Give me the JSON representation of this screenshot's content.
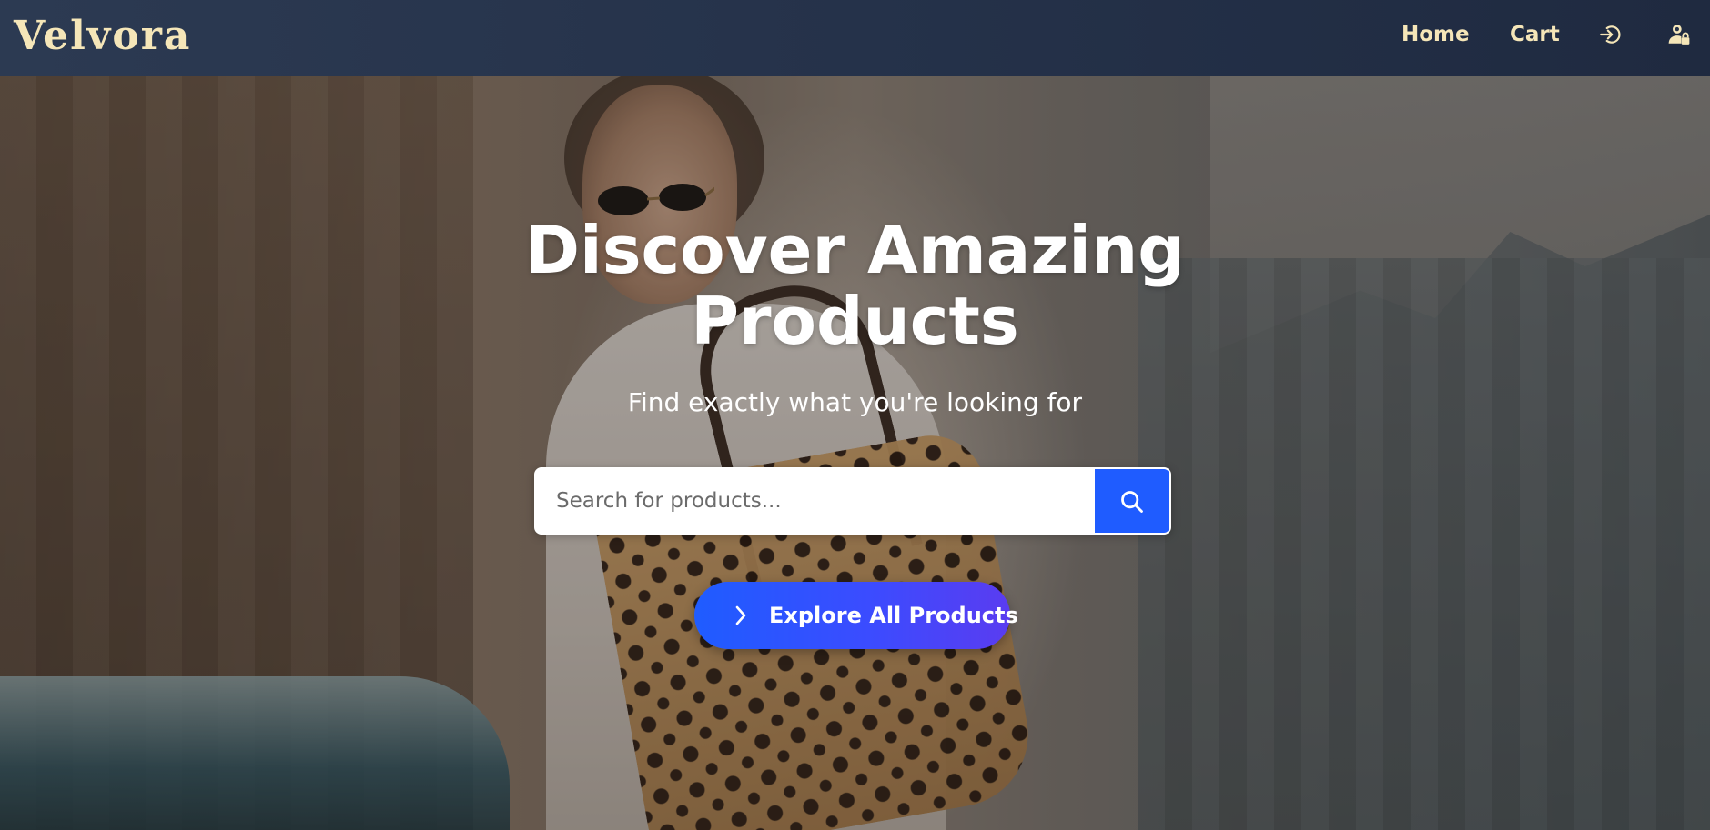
{
  "header": {
    "brand": "Velvora",
    "nav": {
      "home_label": "Home",
      "cart_label": "Cart",
      "login_icon": "login-icon",
      "user_icon": "user-lock-icon"
    }
  },
  "hero": {
    "title_line1": "Discover Amazing",
    "title_line2": "Products",
    "subtitle": "Find exactly what you're looking for",
    "search": {
      "placeholder": "Search for products...",
      "value": "",
      "button_icon": "search-icon"
    },
    "cta": {
      "label": "Explore All Products",
      "icon": "chevron-right-icon"
    },
    "background": "fashion-street-photo"
  },
  "colors": {
    "navbar": "#25324a",
    "brand": "#f5e6b8",
    "accent": "#1f5cff",
    "accent_end": "#5a3cf0",
    "text_on_hero": "#ffffff"
  }
}
